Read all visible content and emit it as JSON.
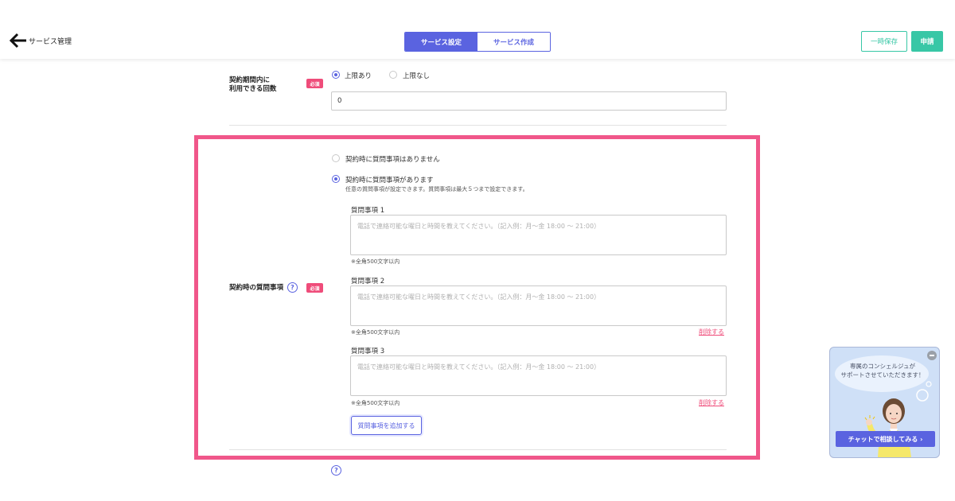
{
  "header": {
    "back_label": "サービス管理",
    "tabs": [
      {
        "label": "サービス設定",
        "active": true
      },
      {
        "label": "サービス作成",
        "active": false
      }
    ],
    "save_label": "一時保存",
    "apply_label": "申請"
  },
  "usage_limit": {
    "label_line1": "契約期間内に",
    "label_line2": "利用できる回数",
    "required": "必須",
    "option_limited": "上限あり",
    "option_unlimited": "上限なし",
    "selected": "上限あり",
    "value": "0"
  },
  "questions": {
    "label": "契約時の質問事項",
    "help": "?",
    "required": "必須",
    "option_none": "契約時に質問事項はありません",
    "option_some": "契約時に質問事項があります",
    "option_some_desc": "任意の質問事項が設定できます。質問事項は最大５つまで設定できます。",
    "selected": "契約時に質問事項があります",
    "items": [
      {
        "label": "質問事項 1",
        "placeholder": "電話で連絡可能な曜日と時間を教えてください。（記入例：月〜金 18:00 〜 21:00）",
        "note": "※全角500文字以内",
        "delete": ""
      },
      {
        "label": "質問事項 2",
        "placeholder": "電話で連絡可能な曜日と時間を教えてください。（記入例：月〜金 18:00 〜 21:00）",
        "note": "※全角500文字以内",
        "delete": "削除する"
      },
      {
        "label": "質問事項 3",
        "placeholder": "電話で連絡可能な曜日と時間を教えてください。（記入例：月〜金 18:00 〜 21:00）",
        "note": "※全角500文字以内",
        "delete": "削除する"
      }
    ],
    "add_label": "質問事項を追加する"
  },
  "bottom_help": "?",
  "chat": {
    "line1": "専属のコンシェルジュが",
    "line2": "サポートさせていただきます！",
    "button": "チャットで相談してみる ›"
  },
  "colors": {
    "accent": "#5a63e0",
    "teal": "#38c7a6",
    "required": "#ef4c7a",
    "highlight": "#f0578a"
  }
}
